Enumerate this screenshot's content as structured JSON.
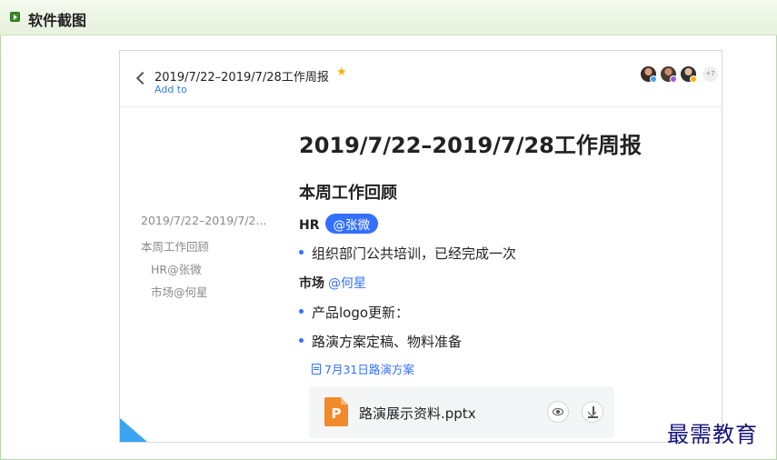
{
  "section": {
    "title": "软件截图"
  },
  "doc_header": {
    "title": "2019/7/22–2019/7/28工作周报",
    "add_to": "Add to",
    "star": "★",
    "avatar_more": "+7"
  },
  "outline": {
    "items": [
      "2019/7/22–2019/7/2...",
      "本周工作回顾",
      "HR@张微",
      "市场@何星"
    ]
  },
  "content": {
    "title": "2019/7/22–2019/7/28工作周报",
    "section_heading": "本周工作回顾",
    "hr_label": "HR",
    "hr_mention": "@张微",
    "bullet_1": "组织部门公共培训，已经完成一次",
    "market_label": "市场",
    "market_mention": "@何星",
    "bullet_2": "产品logo更新：",
    "bullet_3": "路演方案定稿、物料准备",
    "doc_link": "7月31日路演方案",
    "attachment": {
      "icon_letter": "P",
      "file_name": "路演展示资料.pptx"
    }
  },
  "watermark": "最需教育",
  "colors": {
    "accent": "#3370ff",
    "star": "#f5b400",
    "ppt": "#f28a2a",
    "header_green": "#e6f1dc"
  }
}
